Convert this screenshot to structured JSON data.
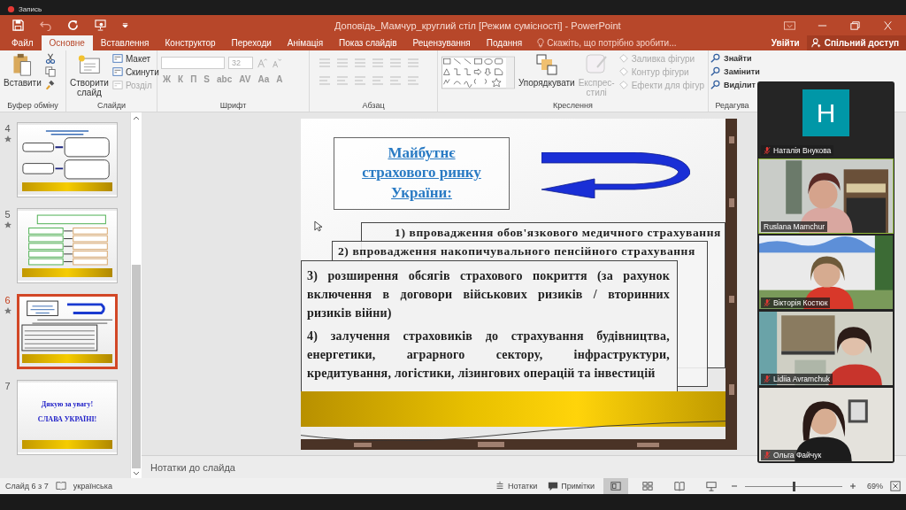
{
  "recording": {
    "label": "Запись"
  },
  "window": {
    "title": "Доповідь_Мамчур_круглий стіл [Режим сумісності] - PowerPoint"
  },
  "tabs": [
    {
      "label": "Файл",
      "selected": false
    },
    {
      "label": "Основне",
      "selected": true
    },
    {
      "label": "Вставлення",
      "selected": false
    },
    {
      "label": "Конструктор",
      "selected": false
    },
    {
      "label": "Переходи",
      "selected": false
    },
    {
      "label": "Анімація",
      "selected": false
    },
    {
      "label": "Показ слайдів",
      "selected": false
    },
    {
      "label": "Рецензування",
      "selected": false
    },
    {
      "label": "Подання",
      "selected": false
    }
  ],
  "tell_me": {
    "placeholder": "Скажіть, що потрібно зробити..."
  },
  "account": {
    "sign_in": "Увійти",
    "share": "Спільний доступ"
  },
  "ribbon": {
    "clipboard": {
      "label": "Буфер обміну",
      "paste": "Вставити"
    },
    "slides": {
      "label": "Слайди",
      "new_slide": "Створити слайд",
      "items": [
        {
          "label": "Макет",
          "disabled": false
        },
        {
          "label": "Скинути",
          "disabled": false
        },
        {
          "label": "Розділ",
          "disabled": true
        }
      ]
    },
    "font": {
      "label": "Шрифт",
      "size": "32",
      "disabled": true,
      "buttons": [
        "Ж",
        "К",
        "П",
        "S",
        "abc",
        "AV",
        "Aa",
        "A"
      ]
    },
    "paragraph": {
      "label": "Абзац",
      "disabled": true
    },
    "drawing": {
      "label": "Креслення",
      "arrange": "Упорядкувати",
      "quick_styles": "Експрес-стилі",
      "quick_styles_disabled": true,
      "items": [
        {
          "label": "Заливка фігури",
          "disabled": true
        },
        {
          "label": "Контур фігури",
          "disabled": true
        },
        {
          "label": "Ефекти для фігур",
          "disabled": true
        }
      ]
    },
    "editing": {
      "label": "Редагува",
      "items": [
        {
          "label": "Знайти"
        },
        {
          "label": "Замінити"
        },
        {
          "label": "Виділит"
        }
      ]
    }
  },
  "slides_panel": [
    {
      "number": "4",
      "selected": false,
      "animated": true,
      "kind": "diagram"
    },
    {
      "number": "5",
      "selected": false,
      "animated": true,
      "kind": "table"
    },
    {
      "number": "6",
      "selected": true,
      "animated": true,
      "kind": "boxes"
    },
    {
      "number": "7",
      "selected": false,
      "animated": false,
      "kind": "closing",
      "lines": [
        "Дякую за увагу!",
        "СЛАВА УКРАЇНІ!"
      ]
    }
  ],
  "slide": {
    "title": "Майбутнє страхового ринку України:",
    "items": [
      "1) впровадження обов'язкового медичного страхування",
      "2) впровадження накопичувального пенсійного страхування",
      "3) розширення обсягів страхового покриття (за рахунок включення в договори військових ризиків / вторинних ризиків війни)",
      "4) залучення страховиків до страхування будівництва, енергетики, аграрного сектору, інфраструктури, кредитування, логістики, лізингових операцій та інвестицій"
    ]
  },
  "notes": {
    "placeholder": "Нотатки до слайда"
  },
  "status": {
    "slide": "Слайд 6 з 7",
    "language": "українська",
    "notes": "Нотатки",
    "comments": "Примітки",
    "views": [
      {
        "kind": "normal",
        "selected": true
      },
      {
        "kind": "sorter",
        "selected": false
      },
      {
        "kind": "reading",
        "selected": false
      },
      {
        "kind": "slideshow",
        "selected": false
      }
    ],
    "zoom": {
      "level": 0.5,
      "label": "69%"
    }
  },
  "participants": [
    {
      "name": "Наталія Внукова",
      "kind": "avatar",
      "initial": "H",
      "muted": true,
      "speaking": false
    },
    {
      "name": "Ruslana Mamchur",
      "kind": "video",
      "muted": false,
      "speaking": true
    },
    {
      "name": "Вікторія Костюк",
      "kind": "video",
      "muted": true,
      "speaking": false
    },
    {
      "name": "Lidiia Avramchuk",
      "kind": "video",
      "muted": true,
      "speaking": false
    },
    {
      "name": "Ольга Файчук",
      "kind": "video",
      "muted": true,
      "speaking": false
    }
  ]
}
